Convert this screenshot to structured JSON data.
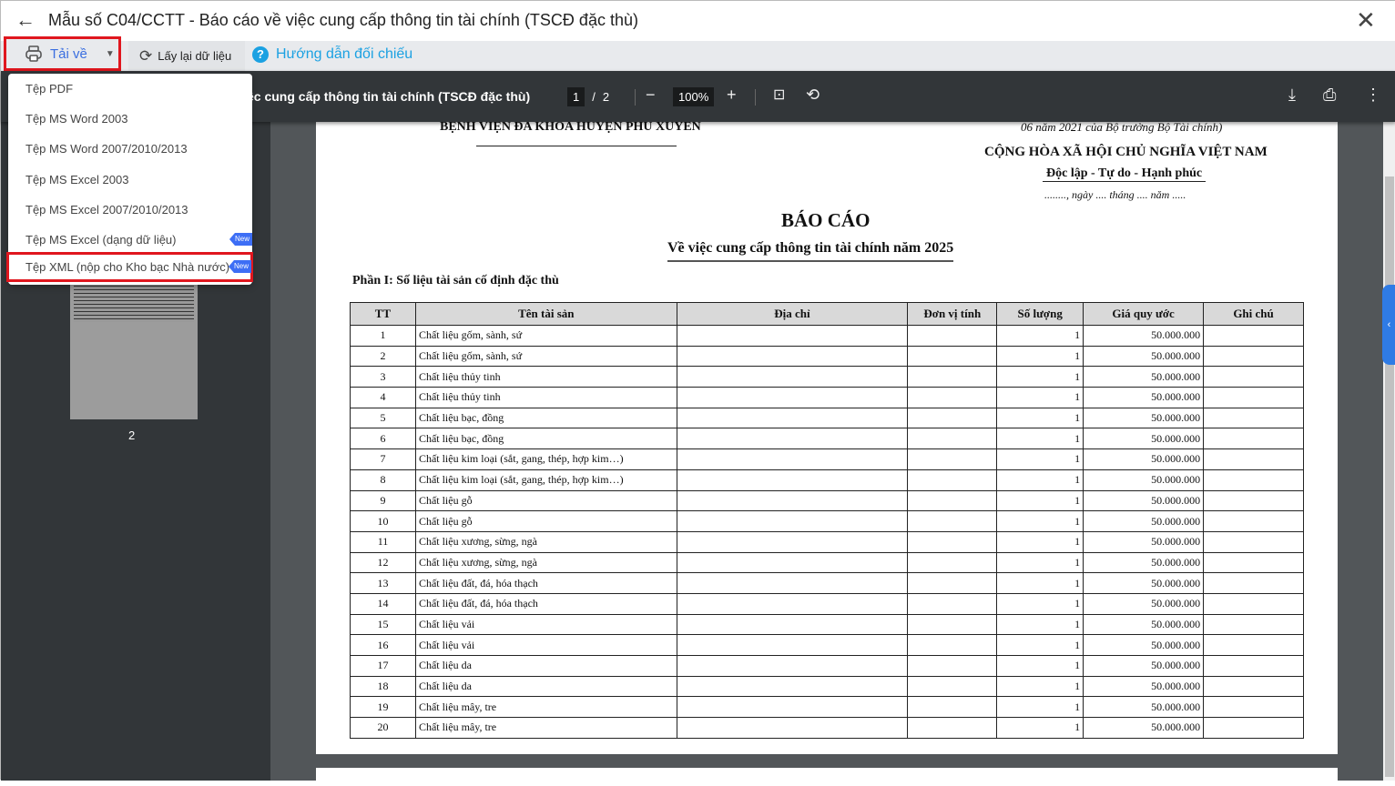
{
  "window": {
    "title": "Mẫu số C04/CCTT - Báo cáo về việc cung cấp thông tin tài chính (TSCĐ đặc thù)"
  },
  "toolbar": {
    "download": "Tải về",
    "reload": "Lấy lại dữ liệu",
    "help": "Hướng dẫn đối chiếu"
  },
  "download_menu": {
    "items": [
      {
        "label": "Tệp PDF"
      },
      {
        "label": "Tệp MS Word 2003"
      },
      {
        "label": "Tệp MS Word 2007/2010/2013"
      },
      {
        "label": "Tệp MS Excel 2003"
      },
      {
        "label": "Tệp MS Excel 2007/2010/2013"
      },
      {
        "label": "Tệp MS Excel (dạng dữ liệu)",
        "badge": "New"
      },
      {
        "label": "Tệp XML (nộp cho Kho bạc Nhà nước)",
        "badge": "New",
        "highlighted": true
      }
    ],
    "badge_color": "#3d6ef5"
  },
  "viewer": {
    "doc_title": "ệc cung cấp thông tin tài chính (TSCĐ đặc thù)",
    "page": "1",
    "total_pages": "2",
    "zoom": "100%",
    "thumbnail_page": "2"
  },
  "doc": {
    "org": "BỆNH VIỆN ĐA KHOA HUYỆN PHÚ XUYÊN",
    "decree": "06 năm 2021 của Bộ trưởng Bộ Tài chính)",
    "nation": "CỘNG HÒA XÃ HỘI CHỦ NGHĨA VIỆT NAM",
    "motto": "Độc lập - Tự do - Hạnh phúc",
    "date": "........, ngày .... tháng .... năm .....",
    "title": "BÁO CÁO",
    "subtitle": "Về việc cung cấp thông tin tài chính năm 2025",
    "section": "Phần I: Số liệu tài sản cố định đặc thù",
    "columns": [
      "TT",
      "Tên tài sản",
      "Địa chỉ",
      "Đơn vị tính",
      "Số lượng",
      "Giá quy ước",
      "Ghi chú"
    ],
    "rows": [
      [
        "1",
        "Chất liệu gốm, sành, sứ",
        "",
        "",
        "1",
        "50.000.000",
        ""
      ],
      [
        "2",
        "Chất liệu gốm, sành, sứ",
        "",
        "",
        "1",
        "50.000.000",
        ""
      ],
      [
        "3",
        "Chất liệu thủy tinh",
        "",
        "",
        "1",
        "50.000.000",
        ""
      ],
      [
        "4",
        "Chất liệu thủy tinh",
        "",
        "",
        "1",
        "50.000.000",
        ""
      ],
      [
        "5",
        "Chất liệu bạc, đồng",
        "",
        "",
        "1",
        "50.000.000",
        ""
      ],
      [
        "6",
        "Chất liệu bạc, đồng",
        "",
        "",
        "1",
        "50.000.000",
        ""
      ],
      [
        "7",
        "Chất liệu kim loại (sắt, gang, thép, hợp kim…)",
        "",
        "",
        "1",
        "50.000.000",
        ""
      ],
      [
        "8",
        "Chất liệu kim loại (sắt, gang, thép, hợp kim…)",
        "",
        "",
        "1",
        "50.000.000",
        ""
      ],
      [
        "9",
        "Chất liệu gỗ",
        "",
        "",
        "1",
        "50.000.000",
        ""
      ],
      [
        "10",
        "Chất liệu gỗ",
        "",
        "",
        "1",
        "50.000.000",
        ""
      ],
      [
        "11",
        "Chất liệu xương, sừng, ngà",
        "",
        "",
        "1",
        "50.000.000",
        ""
      ],
      [
        "12",
        "Chất liệu xương, sừng, ngà",
        "",
        "",
        "1",
        "50.000.000",
        ""
      ],
      [
        "13",
        "Chất liệu đất, đá, hóa thạch",
        "",
        "",
        "1",
        "50.000.000",
        ""
      ],
      [
        "14",
        "Chất liệu đất, đá, hóa thạch",
        "",
        "",
        "1",
        "50.000.000",
        ""
      ],
      [
        "15",
        "Chất liệu vải",
        "",
        "",
        "1",
        "50.000.000",
        ""
      ],
      [
        "16",
        "Chất liệu vải",
        "",
        "",
        "1",
        "50.000.000",
        ""
      ],
      [
        "17",
        "Chất liệu da",
        "",
        "",
        "1",
        "50.000.000",
        ""
      ],
      [
        "18",
        "Chất liệu da",
        "",
        "",
        "1",
        "50.000.000",
        ""
      ],
      [
        "19",
        "Chất liệu mây, tre",
        "",
        "",
        "1",
        "50.000.000",
        ""
      ],
      [
        "20",
        "Chất liệu mây, tre",
        "",
        "",
        "1",
        "50.000.000",
        ""
      ]
    ]
  }
}
